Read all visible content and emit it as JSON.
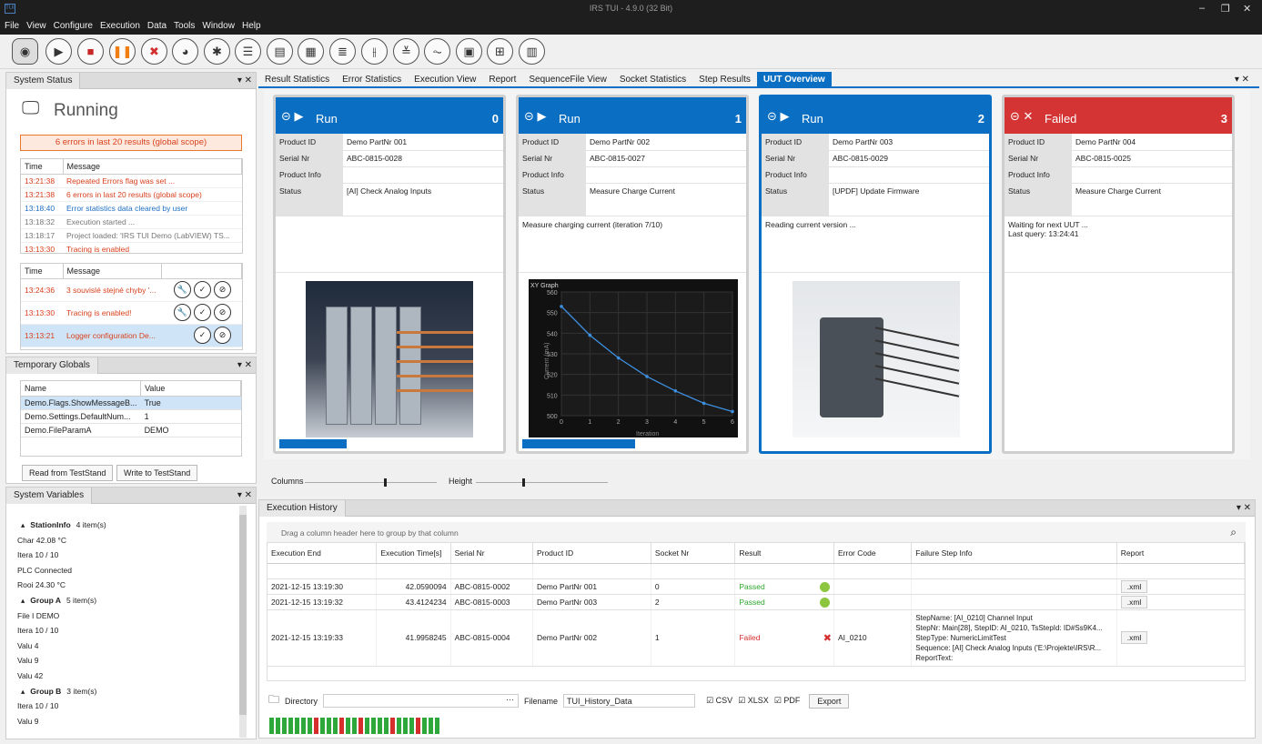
{
  "app": {
    "title": "IRS TUI - 4.9.0 (32 Bit)",
    "logo": "TUI"
  },
  "menu": [
    "File",
    "View",
    "Configure",
    "Execution",
    "Data",
    "Tools",
    "Window",
    "Help"
  ],
  "toolbar_icons": [
    "monitor-icon",
    "run-icon",
    "stop-icon",
    "pause-icon",
    "abort-icon",
    "terminate-icon",
    "debug-icon",
    "checklist-icon",
    "report-list-icon",
    "document-icon",
    "list-icon",
    "adjust-icon",
    "compare-icon",
    "waveform-icon",
    "graph-icon",
    "grid-icon",
    "table-icon"
  ],
  "system_status": {
    "tab": "System Status",
    "state": "Running",
    "error_banner": "6 errors in last 20 results (global scope)",
    "log_headers": [
      "Time",
      "Message"
    ],
    "log": [
      {
        "time": "13:21:38",
        "msg": "Repeated Errors flag was set ...",
        "color": "red"
      },
      {
        "time": "13:21:38",
        "msg": "6 errors in last 20 results (global scope)",
        "color": "red"
      },
      {
        "time": "13:18:40",
        "msg": "Error statistics data cleared by user",
        "color": "blue"
      },
      {
        "time": "13:18:32",
        "msg": "Execution started ...",
        "color": "gray"
      },
      {
        "time": "13:18:17",
        "msg": "Project loaded: 'IRS TUI Demo (LabVIEW) TS...",
        "color": "gray"
      },
      {
        "time": "13:13:30",
        "msg": "Tracing is enabled",
        "color": "red"
      }
    ],
    "alerts": [
      {
        "time": "13:24:36",
        "msg": "3 souvislé stejné chyby '..."
      },
      {
        "time": "13:13:30",
        "msg": "Tracing is enabled!"
      },
      {
        "time": "13:13:21",
        "msg": "Logger configuration De..."
      }
    ]
  },
  "temp_globals": {
    "tab": "Temporary Globals",
    "headers": [
      "Name",
      "Value"
    ],
    "rows": [
      {
        "name": "Demo.Flags.ShowMessageB...",
        "value": "True"
      },
      {
        "name": "Demo.Settings.DefaultNum...",
        "value": "1"
      },
      {
        "name": "Demo.FileParamA",
        "value": "DEMO"
      }
    ],
    "read_btn": "Read from TestStand",
    "write_btn": "Write to TestStand"
  },
  "sys_vars": {
    "tab": "System Variables",
    "groups": [
      {
        "name": "StationInfo",
        "count": "4 item(s)",
        "items": [
          "Char  42.08 °C",
          "Itera  10 / 10",
          "PLC  Connected",
          "Rooi  24.30 °C"
        ]
      },
      {
        "name": "Group A",
        "count": "5 item(s)",
        "items": [
          "File I  DEMO",
          "Itera  10 / 10",
          "Valu  4",
          "Valu  9",
          "Valu  42"
        ]
      },
      {
        "name": "Group B",
        "count": "3 item(s)",
        "items": [
          "Itera  10 / 10",
          "Valu  9"
        ]
      }
    ]
  },
  "tabs": [
    "Result Statistics",
    "Error Statistics",
    "Execution View",
    "Report",
    "SequenceFile View",
    "Socket Statistics",
    "Step Results",
    "UUT Overview"
  ],
  "active_tab": "UUT Overview",
  "cards": [
    {
      "state": "Run",
      "num": "0",
      "product": "Demo PartNr 001",
      "serial": "ABC-0815-0028",
      "info": "",
      "status": "[AI] Check Analog Inputs",
      "msg": "",
      "progress": 0.3,
      "image": "hardware-modules-image"
    },
    {
      "state": "Run",
      "num": "1",
      "product": "Demo PartNr 002",
      "serial": "ABC-0815-0027",
      "info": "",
      "status": "Measure Charge Current",
      "msg": "Measure charging current (iteration 7/10)",
      "progress": 0.5,
      "image": "xy-graph"
    },
    {
      "state": "Run",
      "num": "2",
      "product": "Demo PartNr 003",
      "serial": "ABC-0815-0029",
      "info": "",
      "status": "[UPDF] Update Firmware",
      "msg": "Reading current version ...",
      "progress": 0,
      "image": "hardware-chassis-image"
    },
    {
      "state": "Failed",
      "num": "3",
      "product": "Demo PartNr 004",
      "serial": "ABC-0815-0025",
      "info": "",
      "status": "Measure Charge Current",
      "msg": "Waiting for next UUT ...\nLast query: 13:24:41",
      "progress": 0,
      "image": ""
    }
  ],
  "card_labels": {
    "product": "Product ID",
    "serial": "Serial Nr",
    "info": "Product Info",
    "status": "Status"
  },
  "graph": {
    "title": "XY Graph",
    "xlabel": "Iteration",
    "ylabel": "Current (mA)",
    "yticks": [
      "560",
      "550",
      "540",
      "530",
      "520",
      "510",
      "500"
    ],
    "xticks": [
      "0",
      "1",
      "2",
      "3",
      "4",
      "5",
      "6"
    ]
  },
  "chart_data": {
    "type": "line",
    "title": "XY Graph",
    "xlabel": "Iteration",
    "ylabel": "Current (mA)",
    "x": [
      0,
      1,
      2,
      3,
      4,
      5,
      6
    ],
    "series": [
      {
        "values": [
          553,
          539,
          528,
          519,
          512,
          506,
          502
        ]
      }
    ],
    "xlim": [
      0,
      6
    ],
    "ylim": [
      500,
      560
    ]
  },
  "sliders": {
    "columns": "Columns",
    "height": "Height",
    "columns_value": 0.6,
    "height_value": 0.35
  },
  "history": {
    "tab": "Execution History",
    "group_hint": "Drag a column header here to group by that column",
    "headers": [
      "Execution End",
      "Execution Time[s]",
      "Serial Nr",
      "Product ID",
      "Socket Nr",
      "Result",
      "Error Code",
      "Failure Step Info",
      "Report"
    ],
    "rows": [
      {
        "end": "2021-12-15 13:19:30",
        "time": "42.0590094",
        "serial": "ABC-0815-0002",
        "product": "Demo PartNr 001",
        "socket": "0",
        "result": "Passed",
        "code": "",
        "info": "",
        "report": ".xml"
      },
      {
        "end": "2021-12-15 13:19:32",
        "time": "43.4124234",
        "serial": "ABC-0815-0003",
        "product": "Demo PartNr 003",
        "socket": "2",
        "result": "Passed",
        "code": "",
        "info": "",
        "report": ".xml"
      },
      {
        "end": "2021-12-15 13:19:33",
        "time": "41.9958245",
        "serial": "ABC-0815-0004",
        "product": "Demo PartNr 002",
        "socket": "1",
        "result": "Failed",
        "code": "AI_0210",
        "info": "StepName: [AI_0210] Channel Input\nStepNr: Main[28], StepID: AI_0210, TsStepId: ID#Ss9K4...\nStepType: NumericLimitTest\nSequence: [AI] Check Analog Inputs ('E:\\Projekte\\IRS\\R...\nReportText:",
        "report": ".xml"
      }
    ],
    "directory_label": "Directory",
    "filename_label": "Filename",
    "filename": "TUI_History_Data",
    "csv": "CSV",
    "xlsx": "XLSX",
    "pdf": "PDF",
    "export": "Export"
  }
}
